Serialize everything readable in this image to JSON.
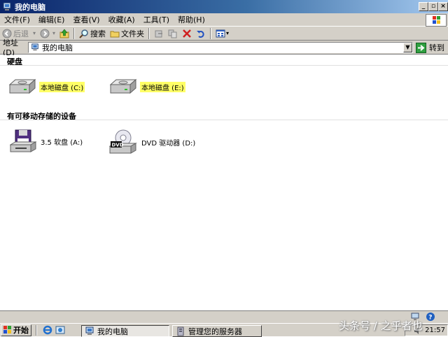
{
  "window": {
    "title": "我的电脑"
  },
  "caption_buttons": {
    "minimize": "_",
    "restore": "▫",
    "close": "×"
  },
  "menu": [
    "文件(F)",
    "编辑(E)",
    "查看(V)",
    "收藏(A)",
    "工具(T)",
    "帮助(H)"
  ],
  "toolbar": {
    "back": "后退",
    "search": "搜索",
    "folders": "文件夹"
  },
  "address": {
    "label": "地址(D)",
    "value": "我的电脑",
    "go": "转到"
  },
  "groups": {
    "hard_disks": {
      "title": "硬盘",
      "items": [
        {
          "label": "本地磁盘 (C:)",
          "highlight": "#ffff66"
        },
        {
          "label": "本地磁盘 (E:)",
          "highlight": "#ffff66"
        }
      ]
    },
    "removable": {
      "title": "有可移动存储的设备",
      "items": [
        {
          "label": "3.5 软盘 (A:)",
          "icon": "floppy-drive-icon"
        },
        {
          "label": "DVD 驱动器 (D:)",
          "icon": "dvd-drive-icon"
        }
      ]
    }
  },
  "taskbar": {
    "start": "开始",
    "tasks": [
      {
        "label": "我的电脑",
        "active": true
      },
      {
        "label": "管理您的服务器",
        "active": false
      }
    ],
    "clock": "21:57"
  },
  "watermark": "头条号 / 之乎者也"
}
